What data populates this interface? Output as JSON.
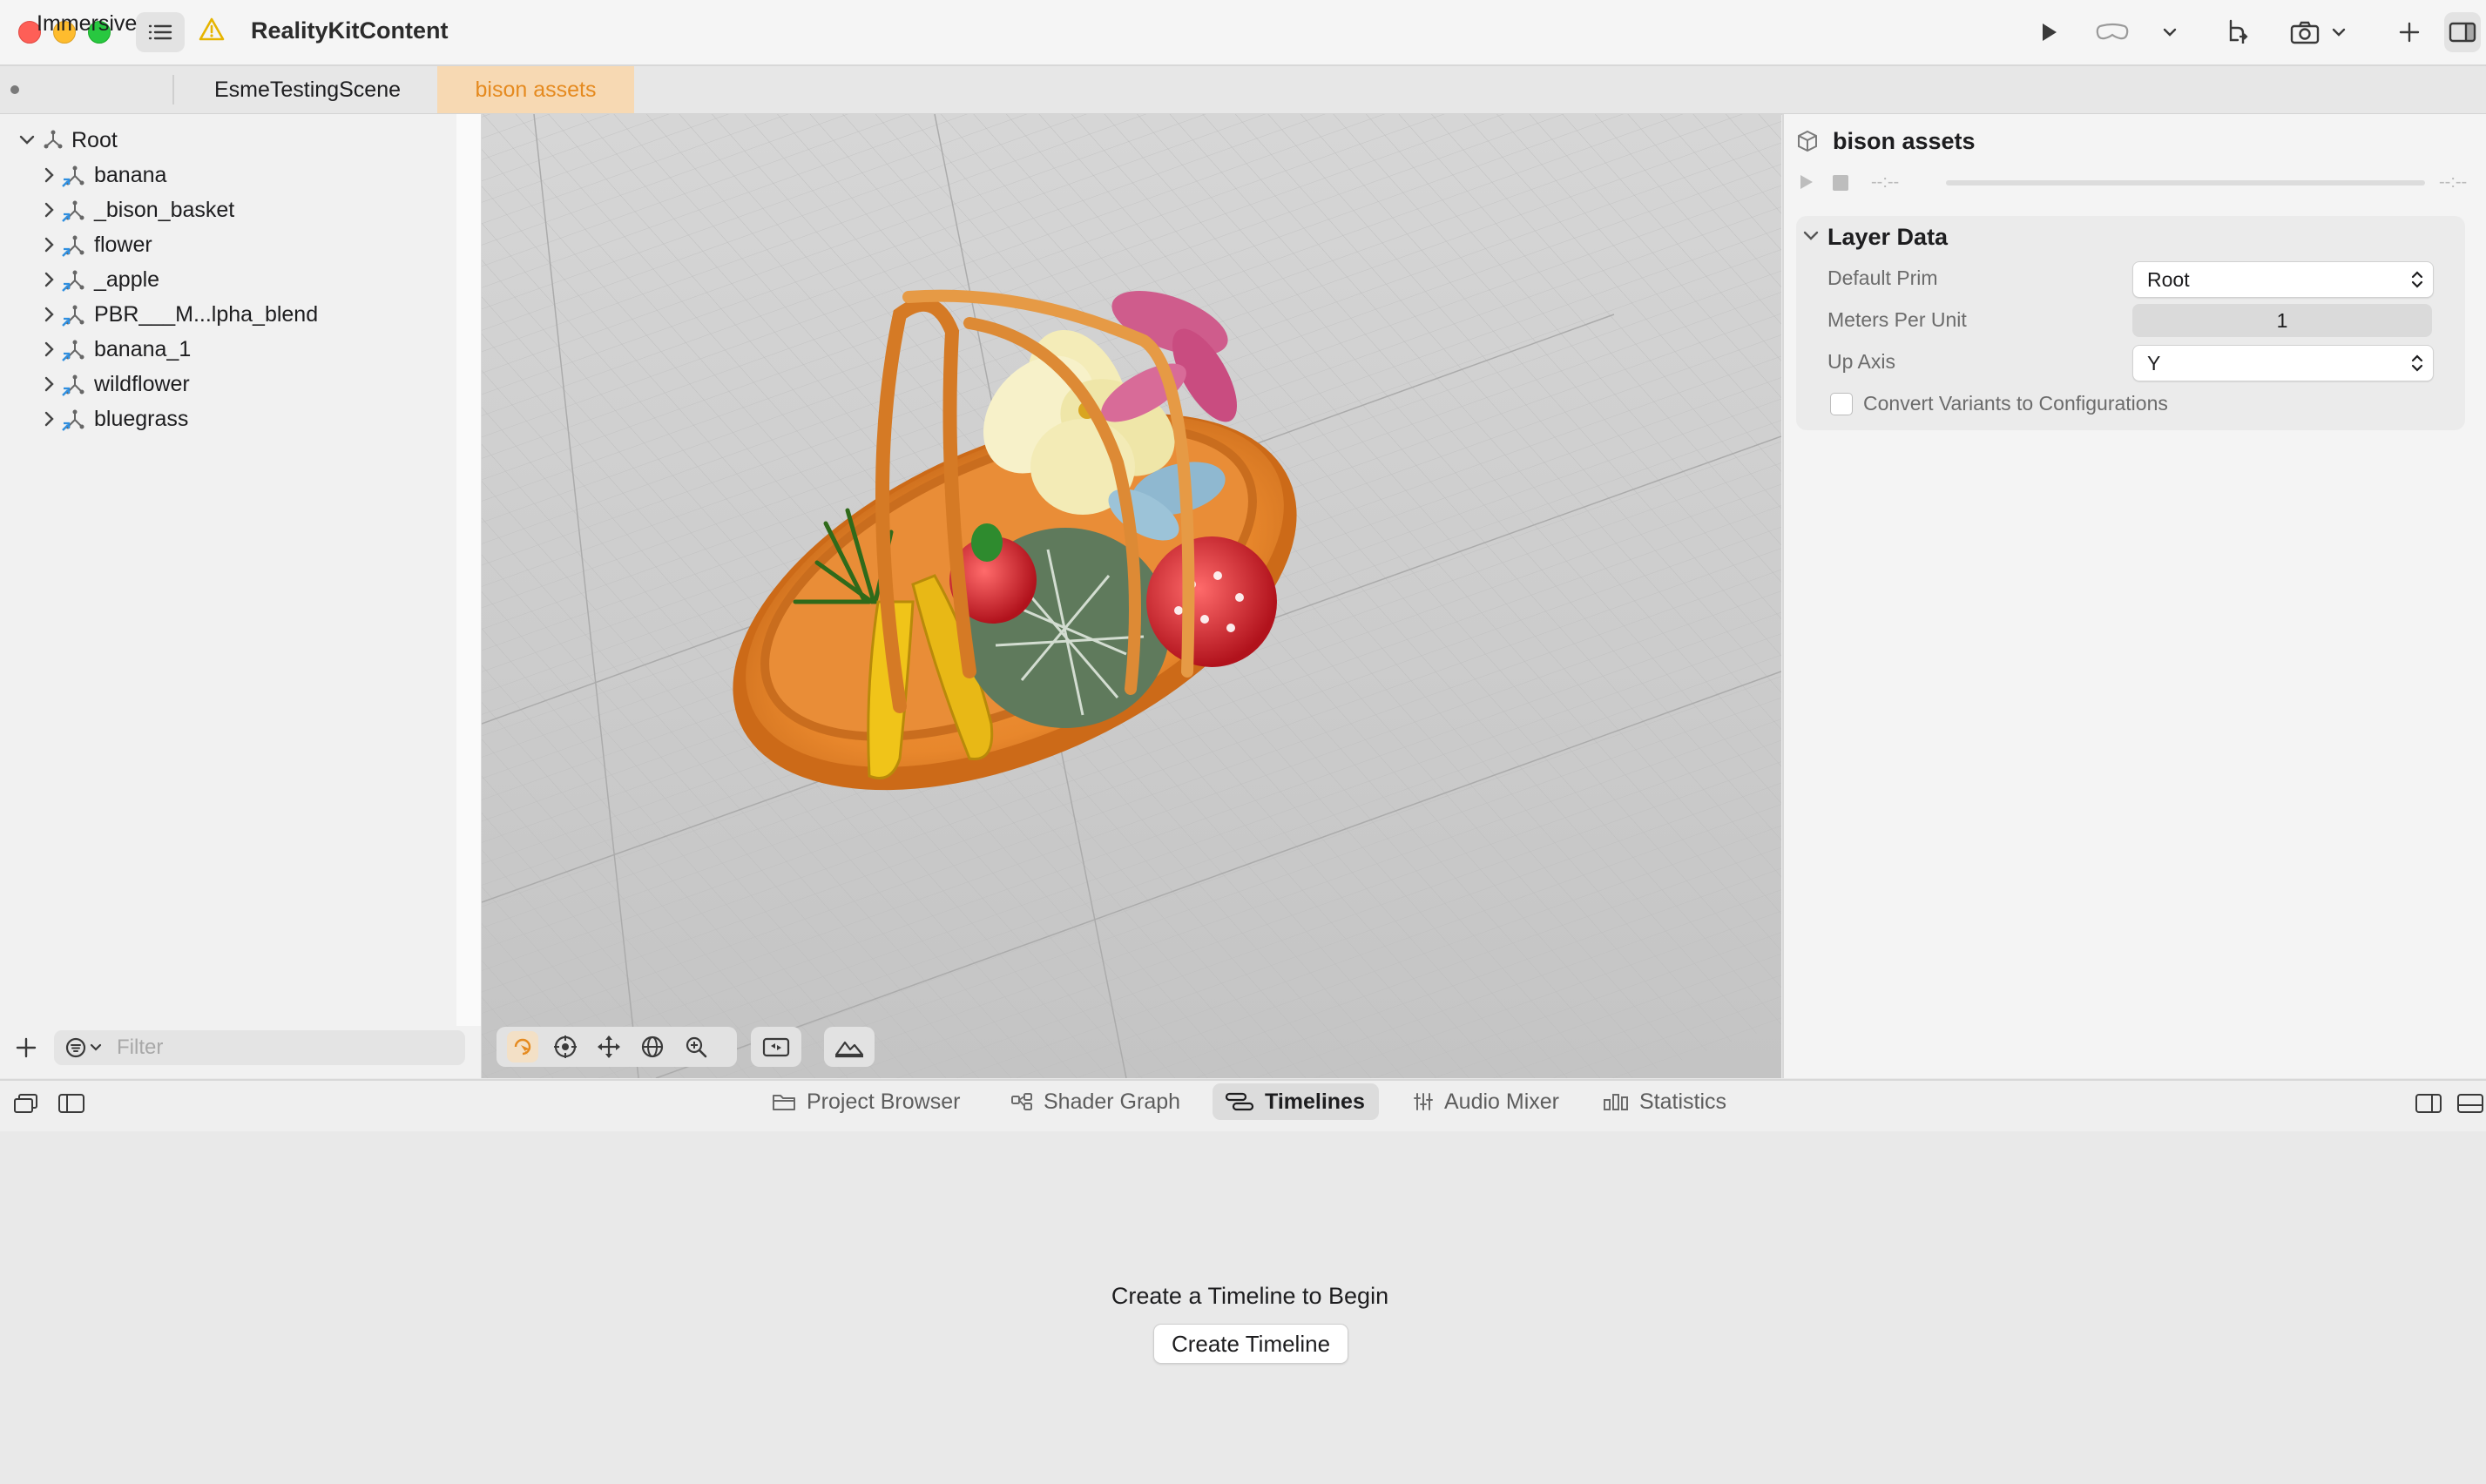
{
  "window": {
    "title": "RealityKitContent"
  },
  "tabs": [
    {
      "label": "Immersive",
      "active": false
    },
    {
      "label": "EsmeTestingScene",
      "active": false
    },
    {
      "label": "bison assets",
      "active": true
    }
  ],
  "navigator": {
    "root_label": "Root",
    "items": [
      {
        "label": "banana"
      },
      {
        "label": "_bison_basket"
      },
      {
        "label": "flower"
      },
      {
        "label": "_apple"
      },
      {
        "label": "PBR___M...lpha_blend"
      },
      {
        "label": "banana_1"
      },
      {
        "label": "wildflower"
      },
      {
        "label": "bluegrass"
      }
    ],
    "filter_placeholder": "Filter"
  },
  "inspector": {
    "title": "bison assets",
    "time_start": "--:--",
    "time_end": "--:--",
    "section_title": "Layer Data",
    "default_prim_label": "Default Prim",
    "default_prim_value": "Root",
    "meters_per_unit_label": "Meters Per Unit",
    "meters_per_unit_value": "1",
    "up_axis_label": "Up Axis",
    "up_axis_value": "Y",
    "convert_variants_label": "Convert Variants to Configurations",
    "convert_variants_checked": false
  },
  "bottom_tabs": [
    {
      "label": "Project Browser",
      "icon": "folder-icon",
      "active": false
    },
    {
      "label": "Shader Graph",
      "icon": "shader-graph-icon",
      "active": false
    },
    {
      "label": "Timelines",
      "icon": "timelines-icon",
      "active": true
    },
    {
      "label": "Audio Mixer",
      "icon": "audio-mixer-icon",
      "active": false
    },
    {
      "label": "Statistics",
      "icon": "statistics-icon",
      "active": false
    }
  ],
  "timeline_panel": {
    "empty_message": "Create a Timeline to Begin",
    "create_button": "Create Timeline"
  },
  "colors": {
    "accent": "#e58a1f",
    "active_tab_bg": "#f7d9b3",
    "viewport_bg": "#c9c9c9"
  }
}
